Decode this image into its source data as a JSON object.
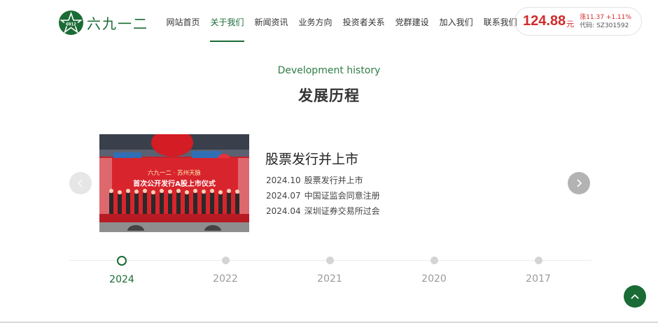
{
  "brand": {
    "logo_text": "六九一二",
    "logo_badge": "6912",
    "logo_color": "#1a6b35"
  },
  "nav": {
    "items": [
      {
        "label": "网站首页"
      },
      {
        "label": "关于我们"
      },
      {
        "label": "新闻资讯"
      },
      {
        "label": "业务方向"
      },
      {
        "label": "投资者关系"
      },
      {
        "label": "党群建设"
      },
      {
        "label": "加入我们"
      },
      {
        "label": "联系我们"
      }
    ],
    "active": "关于我们"
  },
  "stock": {
    "price": "124.88",
    "unit": "元",
    "change": "涨11.37 +1.11%",
    "code": "代码: SZ301592",
    "color": "#d22a2a"
  },
  "section": {
    "title_en": "Development history",
    "title_cn": "发展历程"
  },
  "slide": {
    "photo": {
      "banner_line1": "六九一二 · 苏州天脉",
      "banner_line2": "首次公开发行A股上市仪式"
    },
    "title": "股票发行并上市",
    "events": [
      {
        "date": "2024.10",
        "text": "股票发行并上市"
      },
      {
        "date": "2024.07",
        "text": "中国证监会同意注册"
      },
      {
        "date": "2024.04",
        "text": "深圳证券交易所过会"
      }
    ],
    "prev_icon": "chevron-left-icon",
    "next_icon": "chevron-right-icon"
  },
  "timeline": {
    "years": [
      "2024",
      "2022",
      "2021",
      "2020",
      "2017"
    ],
    "active": "2024"
  },
  "back_to_top_icon": "arrow-up-icon",
  "accent_color": "#1a6b35"
}
